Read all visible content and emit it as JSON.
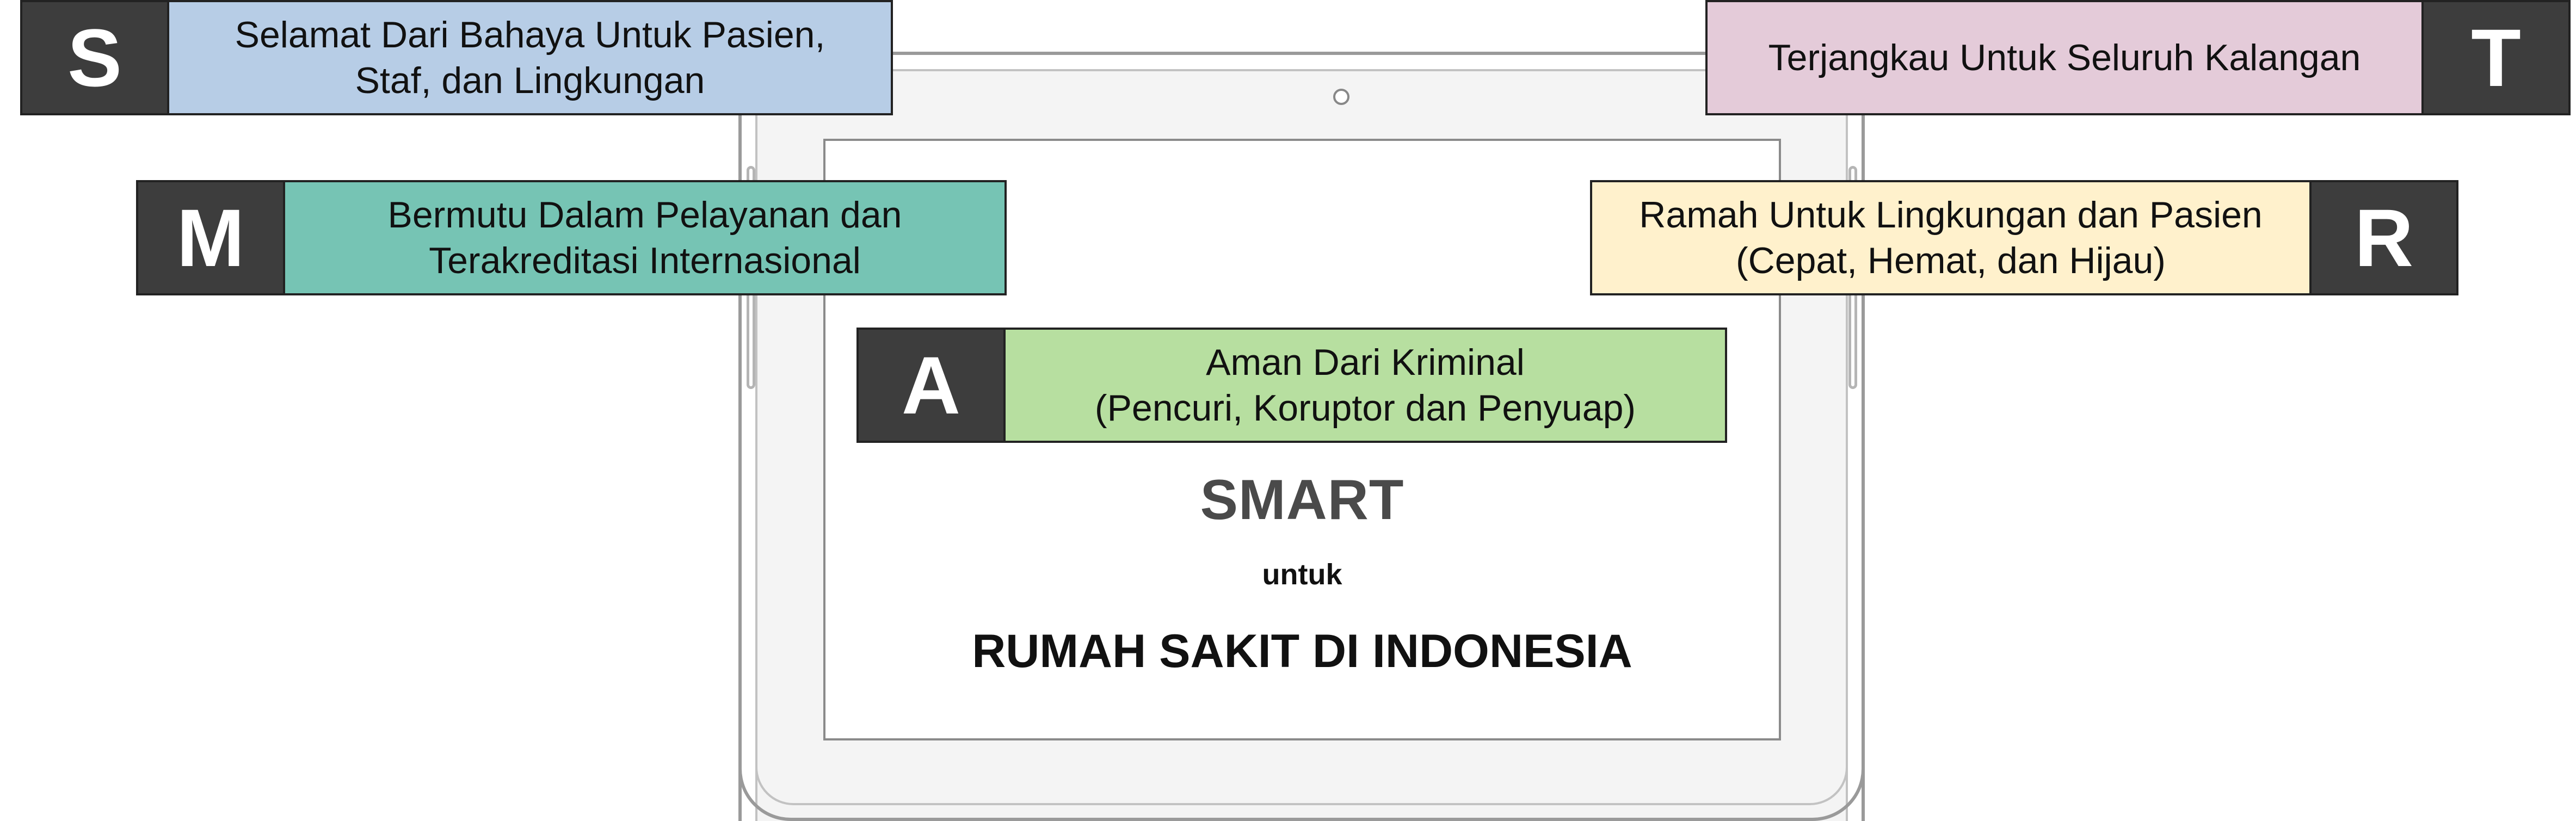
{
  "items": {
    "s": {
      "letter": "S",
      "lines": [
        "Selamat Dari Bahaya Untuk Pasien,",
        "Staf, dan Lingkungan"
      ],
      "color": "#b7cde6"
    },
    "t": {
      "letter": "T",
      "lines": [
        "Terjangkau Untuk Seluruh Kalangan"
      ],
      "color": "#e4cbd9"
    },
    "m": {
      "letter": "M",
      "lines": [
        "Bermutu Dalam Pelayanan dan",
        "Terakreditasi Internasional"
      ],
      "color": "#76c4b4"
    },
    "r": {
      "letter": "R",
      "lines": [
        "Ramah Untuk Lingkungan dan Pasien",
        "(Cepat, Hemat, dan Hijau)"
      ],
      "color": "#fff1cc"
    },
    "a": {
      "letter": "A",
      "lines": [
        "Aman Dari Kriminal",
        "(Pencuri, Koruptor dan Penyuap)"
      ],
      "color": "#b7dfa0"
    }
  },
  "screen": {
    "title": "SMART",
    "connector": "untuk",
    "subtitle": "RUMAH SAKIT DI INDONESIA"
  },
  "colors": {
    "letter_box": "#3d3d3d",
    "letter_text": "#ffffff",
    "tablet_frame": "#9a9a9a"
  }
}
